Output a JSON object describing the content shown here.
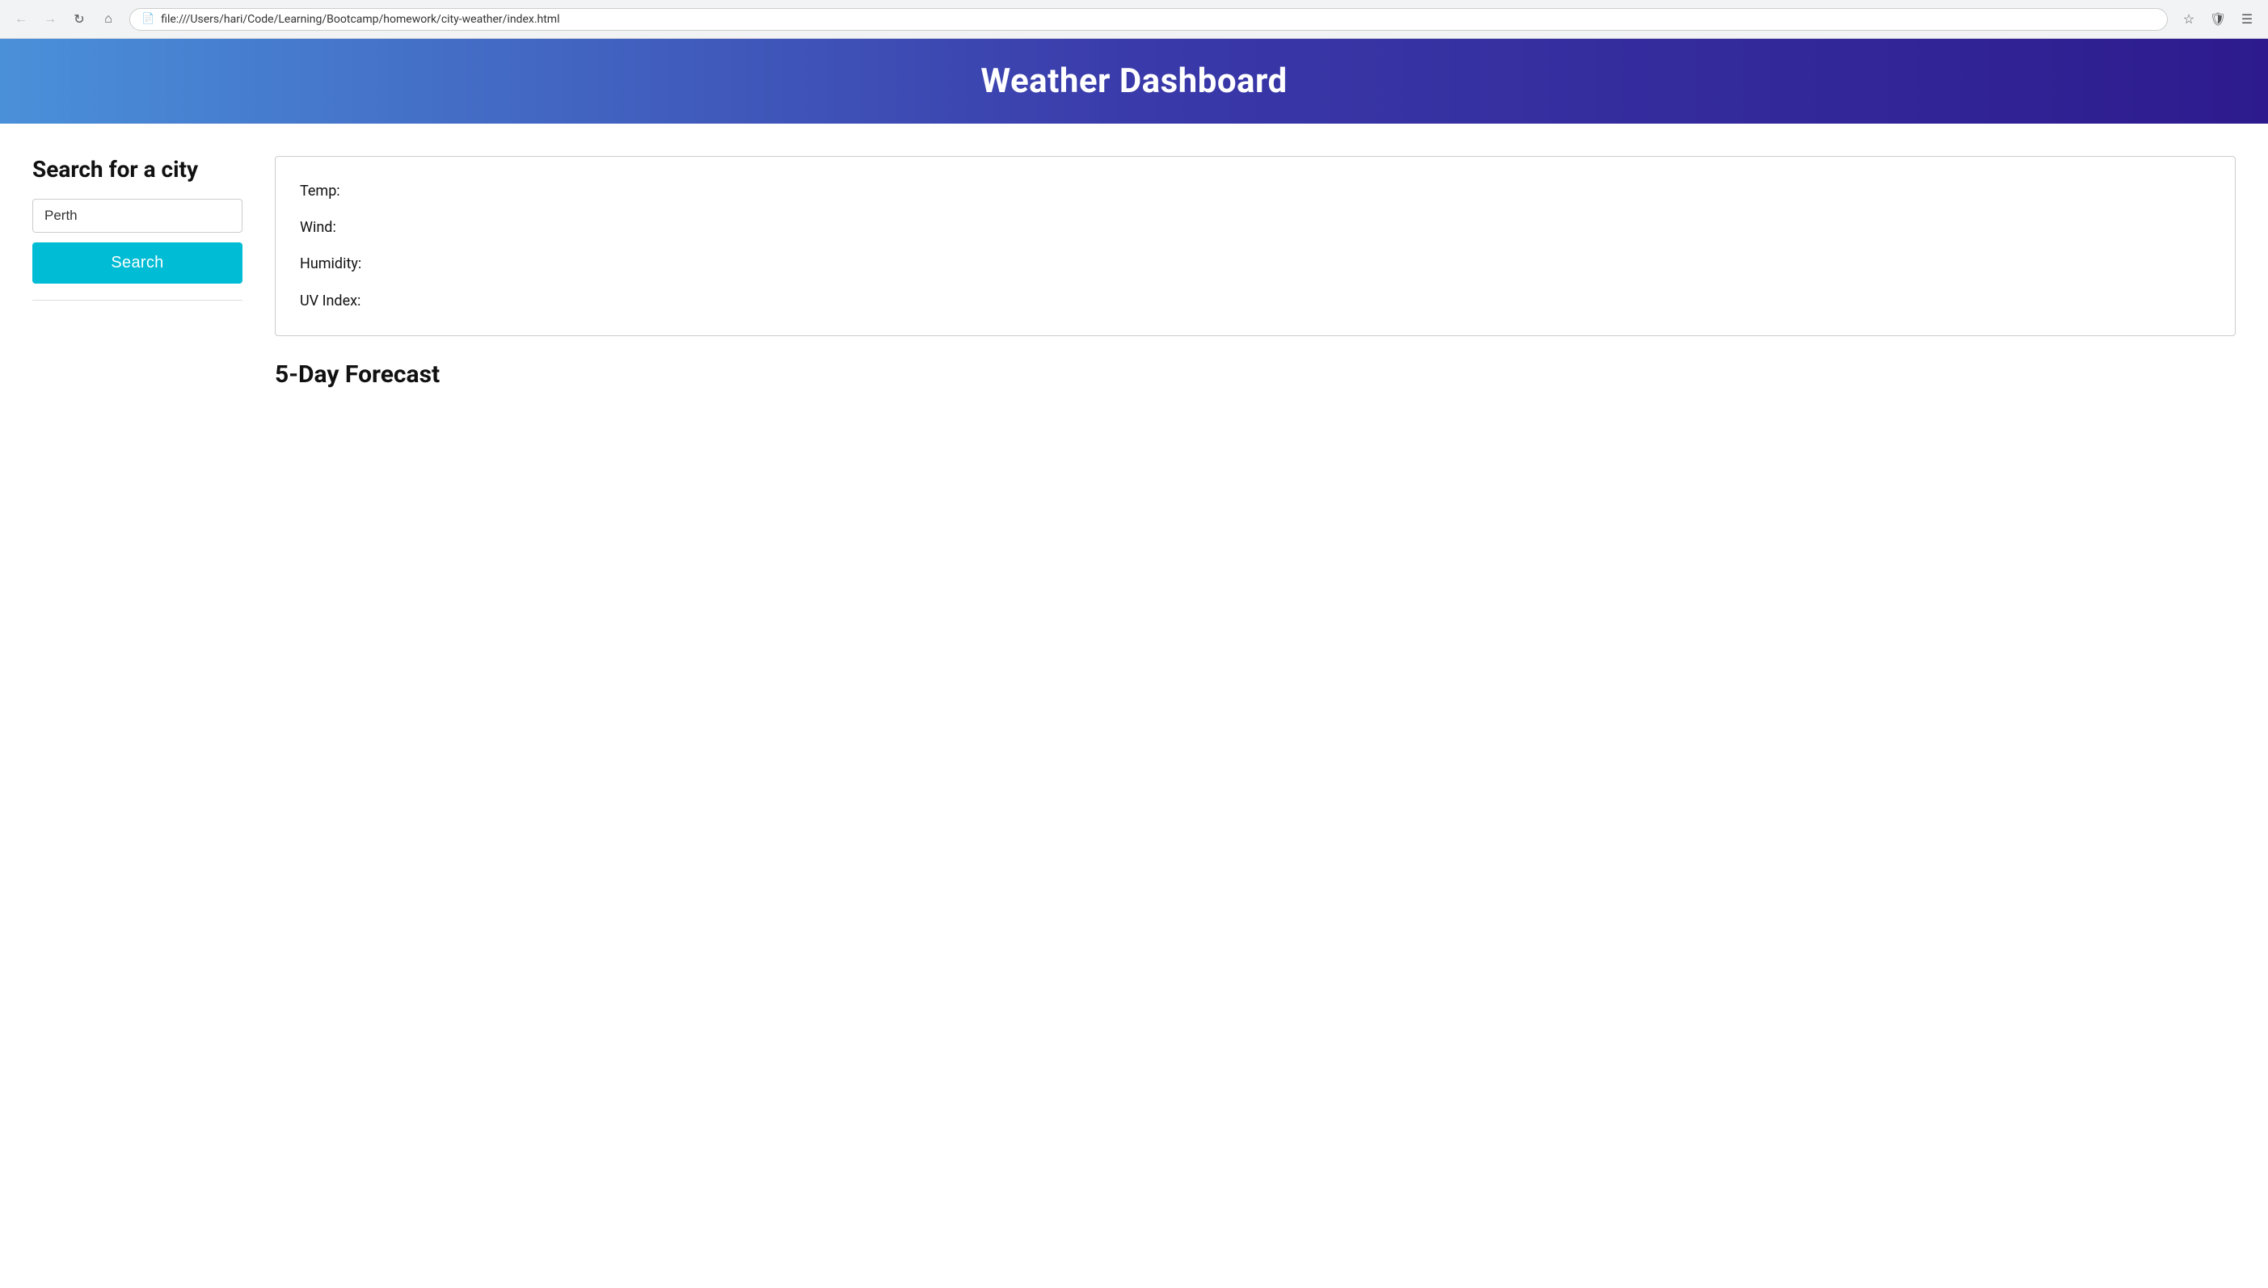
{
  "browser": {
    "url": "file:///Users/hari/Code/Learning/Bootcamp/homework/city-weather/index.html"
  },
  "header": {
    "title": "Weather Dashboard"
  },
  "sidebar": {
    "search_heading": "Search for a city",
    "city_input_value": "Perth",
    "city_input_placeholder": "Search for a city",
    "search_button_label": "Search"
  },
  "weather_card": {
    "temp_label": "Temp:",
    "wind_label": "Wind:",
    "humidity_label": "Humidity:",
    "uv_index_label": "UV Index:"
  },
  "forecast": {
    "heading": "5-Day Forecast"
  }
}
